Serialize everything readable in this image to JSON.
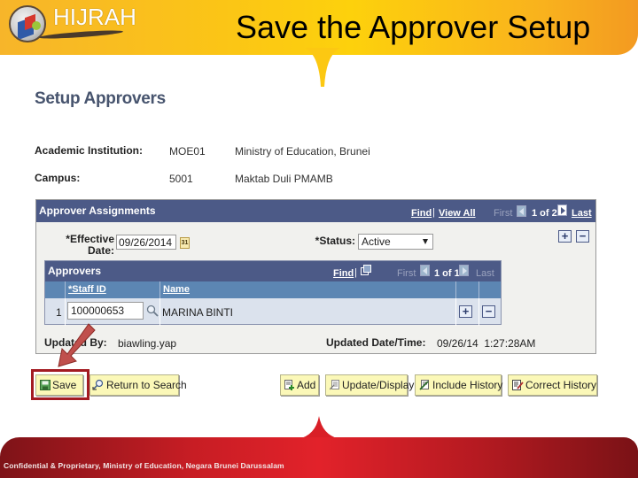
{
  "slide": {
    "title": "Save the Approver Setup",
    "logo_text": "HIJRAH",
    "footer_text": "Confidential & Proprietary, Ministry of Education, Negara Brunei Darussalam",
    "colors": {
      "banner": "#fbc516",
      "footer": "#c71d24",
      "highlight": "#a31b22"
    }
  },
  "page": {
    "title": "Setup Approvers",
    "fields": [
      {
        "label": "Academic Institution:",
        "code": "MOE01",
        "description": "Ministry of Education, Brunei"
      },
      {
        "label": "Campus:",
        "code": "5001",
        "description": "Maktab Duli PMAMB"
      }
    ]
  },
  "assignments": {
    "title": "Approver Assignments",
    "find_label": "Find",
    "separator": "|",
    "view_all_label": "View All",
    "first_label": "First",
    "pager_text": "1 of 2",
    "last_label": "Last",
    "effective_date_label": "*Effective Date:",
    "effective_date_value": "09/26/2014",
    "calendar_icon_text": "31",
    "status_label": "*Status:",
    "status_value": "Active",
    "add_symbol": "+",
    "remove_symbol": "−",
    "approvers": {
      "title": "Approvers",
      "find_label": "Find",
      "separator": "|",
      "first_label": "First",
      "pager_text": "1 of 1",
      "last_label": "Last",
      "columns": [
        "*Staff ID",
        "Name"
      ],
      "rows": [
        {
          "num": "1",
          "staff_id": "100000653",
          "name": "MARINA BINTI"
        }
      ]
    },
    "updated_by_label": "Updated By:",
    "updated_by_value": "biawling.yap",
    "updated_dt_label": "Updated Date/Time:",
    "updated_dt_value": "09/26/14  1:27:28AM"
  },
  "buttons": {
    "save": "Save",
    "return_to_search": "Return to Search",
    "add": "Add",
    "update_display": "Update/Display",
    "include_history": "Include History",
    "correct_history": "Correct History"
  }
}
